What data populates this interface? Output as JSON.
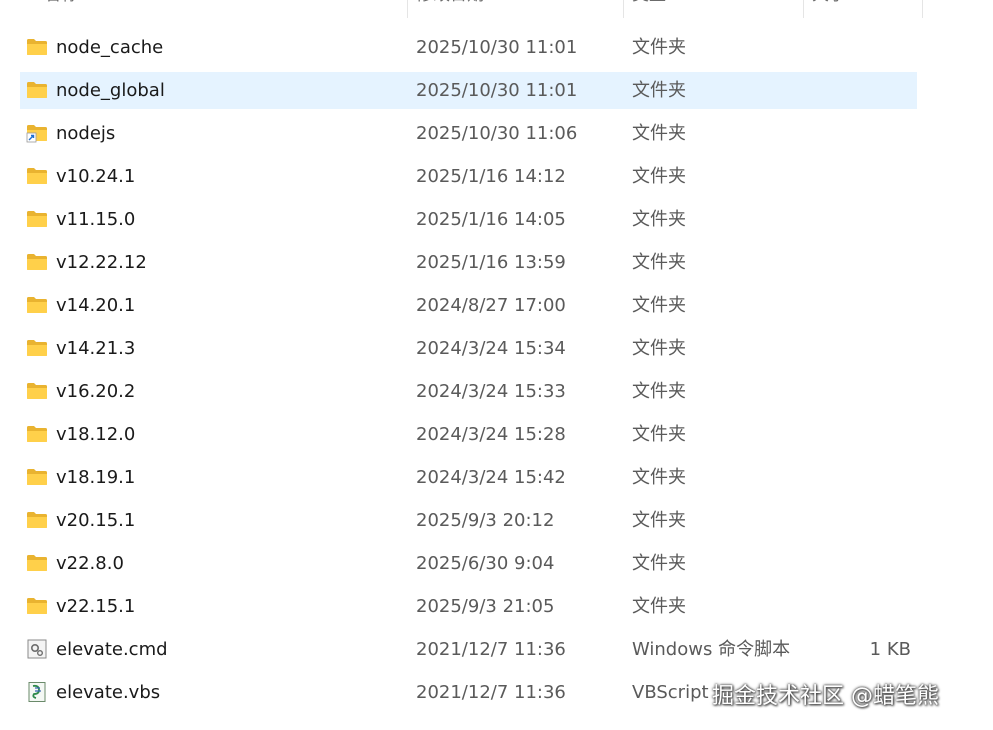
{
  "columns": {
    "name": "名称",
    "date": "修改日期",
    "type": "类型",
    "size": "大小"
  },
  "rows": [
    {
      "name": "node_cache",
      "date": "2025/10/30 11:01",
      "type": "文件夹",
      "size": "",
      "icon": "folder-icon",
      "selected": false
    },
    {
      "name": "node_global",
      "date": "2025/10/30 11:01",
      "type": "文件夹",
      "size": "",
      "icon": "folder-icon",
      "selected": true
    },
    {
      "name": "nodejs",
      "date": "2025/10/30 11:06",
      "type": "文件夹",
      "size": "",
      "icon": "shortcut-folder-icon",
      "selected": false
    },
    {
      "name": "v10.24.1",
      "date": "2025/1/16 14:12",
      "type": "文件夹",
      "size": "",
      "icon": "folder-icon",
      "selected": false
    },
    {
      "name": "v11.15.0",
      "date": "2025/1/16 14:05",
      "type": "文件夹",
      "size": "",
      "icon": "folder-icon",
      "selected": false
    },
    {
      "name": "v12.22.12",
      "date": "2025/1/16 13:59",
      "type": "文件夹",
      "size": "",
      "icon": "folder-icon",
      "selected": false
    },
    {
      "name": "v14.20.1",
      "date": "2024/8/27 17:00",
      "type": "文件夹",
      "size": "",
      "icon": "folder-icon",
      "selected": false
    },
    {
      "name": "v14.21.3",
      "date": "2024/3/24 15:34",
      "type": "文件夹",
      "size": "",
      "icon": "folder-icon",
      "selected": false
    },
    {
      "name": "v16.20.2",
      "date": "2024/3/24 15:33",
      "type": "文件夹",
      "size": "",
      "icon": "folder-icon",
      "selected": false
    },
    {
      "name": "v18.12.0",
      "date": "2024/3/24 15:28",
      "type": "文件夹",
      "size": "",
      "icon": "folder-icon",
      "selected": false
    },
    {
      "name": "v18.19.1",
      "date": "2024/3/24 15:42",
      "type": "文件夹",
      "size": "",
      "icon": "folder-icon",
      "selected": false
    },
    {
      "name": "v20.15.1",
      "date": "2025/9/3 20:12",
      "type": "文件夹",
      "size": "",
      "icon": "folder-icon",
      "selected": false
    },
    {
      "name": "v22.8.0",
      "date": "2025/6/30 9:04",
      "type": "文件夹",
      "size": "",
      "icon": "folder-icon",
      "selected": false
    },
    {
      "name": "v22.15.1",
      "date": "2025/9/3 21:05",
      "type": "文件夹",
      "size": "",
      "icon": "folder-icon",
      "selected": false
    },
    {
      "name": "elevate.cmd",
      "date": "2021/12/7 11:36",
      "type": "Windows 命令脚本",
      "size": "1 KB",
      "icon": "cmd-file-icon",
      "selected": false
    },
    {
      "name": "elevate.vbs",
      "date": "2021/12/7 11:36",
      "type": "VBScript",
      "size": "",
      "icon": "vbs-file-icon",
      "selected": false
    }
  ],
  "watermark": "掘金技术社区 @蜡笔熊",
  "colors": {
    "selected_row_bg": "#e5f3ff",
    "folder_yellow": "#ffd04a",
    "folder_dark": "#e9b330"
  }
}
